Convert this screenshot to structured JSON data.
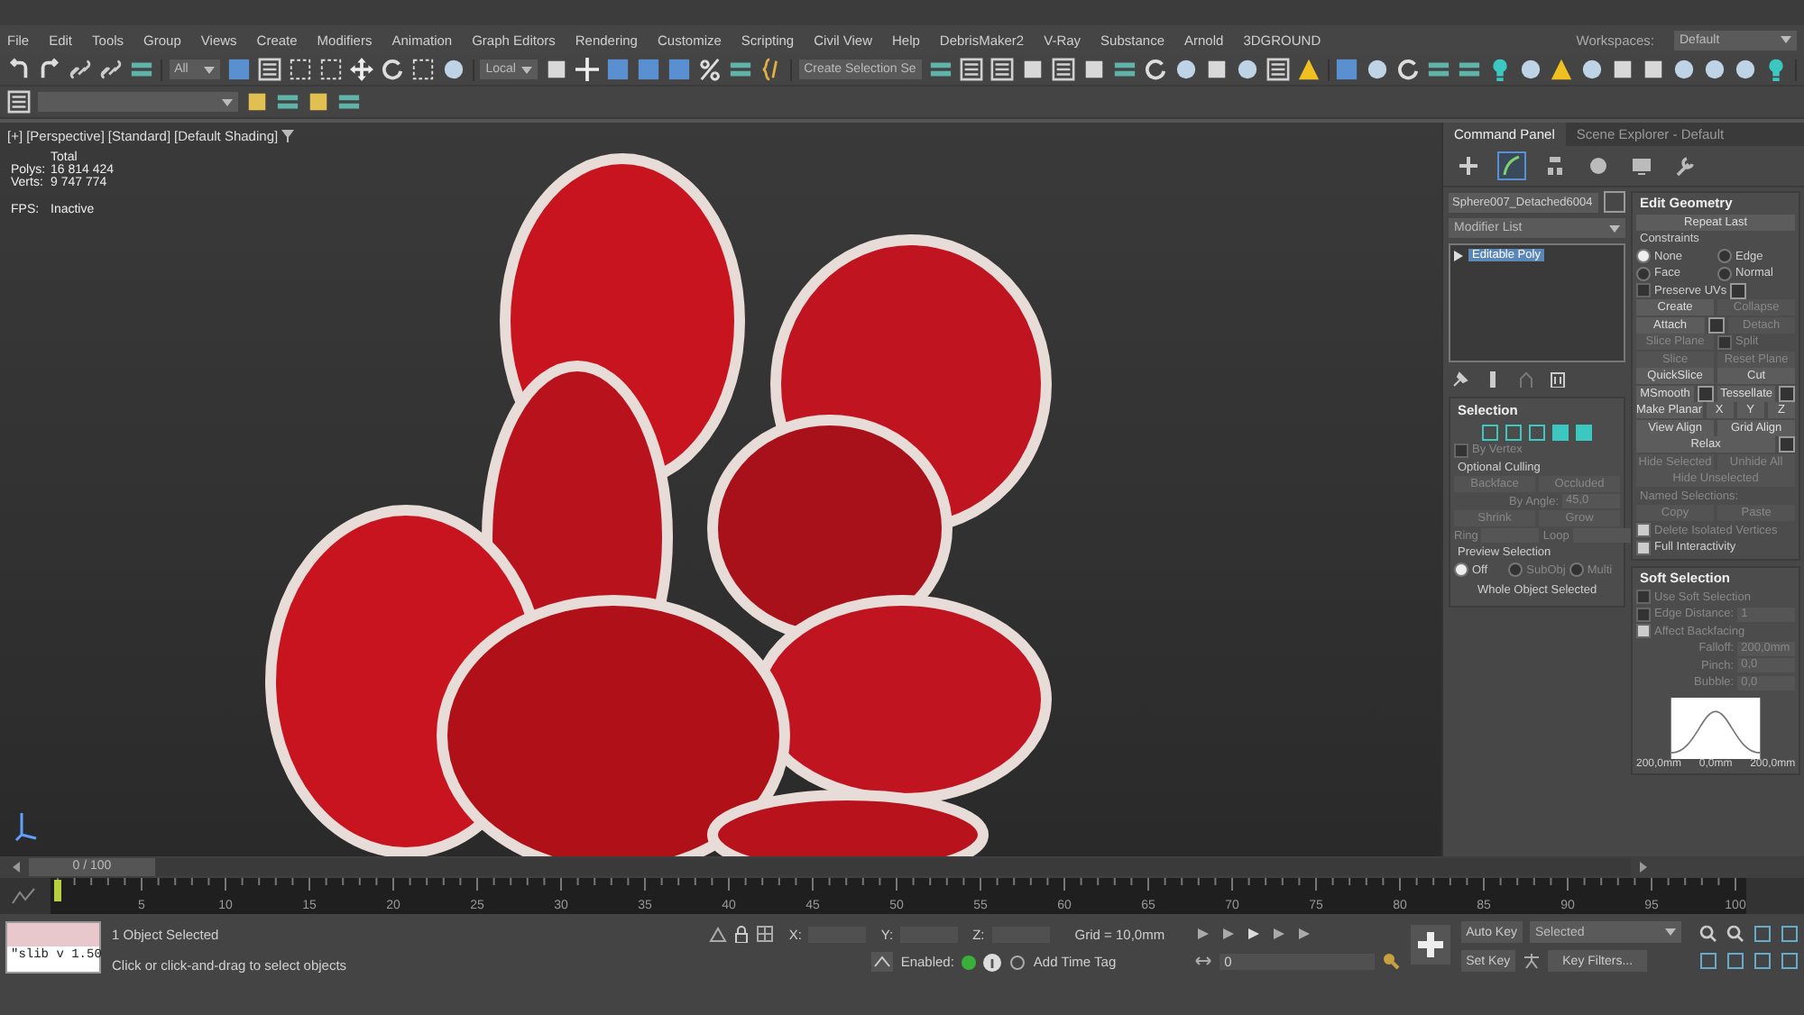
{
  "menu_bar": [
    "File",
    "Edit",
    "Tools",
    "Group",
    "Views",
    "Create",
    "Modifiers",
    "Animation",
    "Graph Editors",
    "Rendering",
    "Customize",
    "Scripting",
    "Civil View",
    "Help",
    "DebrisMaker2",
    "V-Ray",
    "Substance",
    "Arnold",
    "3DGROUND"
  ],
  "workspaces": {
    "label": "Workspaces:",
    "value": "Default"
  },
  "toolbar": {
    "selection_filter": "All",
    "reference_coord": "Local",
    "selection_set": "Create Selection Se"
  },
  "viewport": {
    "labels": [
      "[+]",
      "[Perspective]",
      "[Standard]",
      "[Default Shading]"
    ],
    "stats_title": "Total",
    "stats": [
      {
        "label": "Polys:",
        "value": "16 814 424"
      },
      {
        "label": "Verts:",
        "value": "9 747 774"
      }
    ],
    "fps": {
      "label": "FPS:",
      "value": "Inactive"
    }
  },
  "command_panel": {
    "tabs": [
      {
        "label": "Command Panel",
        "selected": true
      },
      {
        "label": "Scene Explorer - Default",
        "selected": false
      }
    ],
    "mode_tabs": [
      {
        "selected": false
      },
      {
        "selected": true
      },
      {
        "selected": false
      },
      {
        "selected": false
      },
      {
        "selected": false
      },
      {
        "selected": false
      }
    ],
    "object_name": "Sphere007_Detached6004",
    "modifier_list": "Modifier List",
    "stack": [
      {
        "label": "Editable Poly",
        "selected": true
      }
    ],
    "selection": {
      "title": "Selection",
      "rows": [
        {
          "items": [
            {
              "kind": "check",
              "label": "By Vertex",
              "checked": false,
              "disabled": true
            }
          ]
        },
        {
          "items": [
            {
              "kind": "label",
              "label": "Optional Culling"
            }
          ]
        },
        {
          "items": [
            {
              "kind": "button",
              "label": "Backface",
              "disabled": true
            },
            {
              "kind": "button",
              "label": "Occluded",
              "disabled": true
            }
          ]
        },
        {
          "items": [
            {
              "kind": "spinner",
              "label": "By Angle:",
              "value": "45,0",
              "disabled": true
            }
          ]
        },
        {
          "items": [
            {
              "kind": "button",
              "label": "Shrink",
              "disabled": true
            },
            {
              "kind": "button",
              "label": "Grow",
              "disabled": true
            }
          ]
        },
        {
          "items": [
            {
              "kind": "spinner",
              "label": "Ring",
              "disabled": true
            },
            {
              "kind": "spinner",
              "label": "Loop",
              "disabled": true
            }
          ]
        },
        {
          "items": [
            {
              "kind": "label",
              "label": "Preview Selection"
            }
          ]
        },
        {
          "items": [
            {
              "kind": "radio",
              "label": "Off",
              "selected": true,
              "disabled": false
            },
            {
              "kind": "radio",
              "label": "SubObj",
              "selected": false,
              "disabled": true
            },
            {
              "kind": "radio",
              "label": "Multi",
              "selected": false,
              "disabled": true
            }
          ]
        },
        {
          "items": [
            {
              "kind": "text",
              "label": "Whole Object Selected"
            }
          ]
        }
      ]
    },
    "edit_geometry": {
      "title": "Edit Geometry",
      "rows": [
        {
          "items": [
            {
              "kind": "button",
              "label": "Repeat Last",
              "disabled": false
            }
          ]
        },
        {
          "items": [
            {
              "kind": "label",
              "label": "Constraints"
            }
          ]
        },
        {
          "items": [
            {
              "kind": "radio",
              "label": "None",
              "selected": true,
              "disabled": false
            },
            {
              "kind": "radio",
              "label": "Edge",
              "selected": false,
              "disabled": false
            }
          ]
        },
        {
          "items": [
            {
              "kind": "radio",
              "label": "Face",
              "selected": false,
              "disabled": false
            },
            {
              "kind": "radio",
              "label": "Normal",
              "selected": false,
              "disabled": false
            }
          ]
        },
        {
          "items": [
            {
              "kind": "check",
              "label": "Preserve UVs",
              "checked": false,
              "disabled": false,
              "settings": true
            }
          ]
        },
        {
          "items": [
            {
              "kind": "button",
              "label": "Create",
              "disabled": false
            },
            {
              "kind": "button",
              "label": "Collapse",
              "disabled": true
            }
          ]
        },
        {
          "items": [
            {
              "kind": "button",
              "label": "Attach",
              "disabled": false,
              "settings": true
            },
            {
              "kind": "button",
              "label": "Detach",
              "disabled": true
            }
          ]
        },
        {
          "items": [
            {
              "kind": "button",
              "label": "Slice Plane",
              "disabled": true
            },
            {
              "kind": "check",
              "label": "Split",
              "checked": false,
              "disabled": true
            }
          ]
        },
        {
          "items": [
            {
              "kind": "button",
              "label": "Slice",
              "disabled": true
            },
            {
              "kind": "button",
              "label": "Reset Plane",
              "disabled": true
            }
          ]
        },
        {
          "items": [
            {
              "kind": "button",
              "label": "QuickSlice",
              "disabled": false
            },
            {
              "kind": "button",
              "label": "Cut",
              "disabled": false
            }
          ]
        },
        {
          "items": [
            {
              "kind": "button",
              "label": "MSmooth",
              "disabled": false,
              "settings": true
            },
            {
              "kind": "button",
              "label": "Tessellate",
              "disabled": false,
              "settings": true
            }
          ]
        },
        {
          "items": [
            {
              "kind": "button",
              "label": "Make Planar",
              "disabled": false
            },
            {
              "kind": "button",
              "label": "X",
              "disabled": false
            },
            {
              "kind": "button",
              "label": "Y",
              "disabled": false
            },
            {
              "kind": "button",
              "label": "Z",
              "disabled": false
            }
          ]
        },
        {
          "items": [
            {
              "kind": "button",
              "label": "View Align",
              "disabled": false
            },
            {
              "kind": "button",
              "label": "Grid Align",
              "disabled": false
            }
          ]
        },
        {
          "items": [
            {
              "kind": "button",
              "label": "Relax",
              "disabled": false,
              "settings": true
            }
          ]
        },
        {
          "items": [
            {
              "kind": "button",
              "label": "Hide Selected",
              "disabled": true
            },
            {
              "kind": "button",
              "label": "Unhide All",
              "disabled": true
            }
          ]
        },
        {
          "items": [
            {
              "kind": "button",
              "label": "Hide Unselected",
              "disabled": true
            }
          ]
        },
        {
          "items": [
            {
              "kind": "label",
              "label": "Named Selections:",
              "disabled": true
            }
          ]
        },
        {
          "items": [
            {
              "kind": "button",
              "label": "Copy",
              "disabled": true
            },
            {
              "kind": "button",
              "label": "Paste",
              "disabled": true
            }
          ]
        },
        {
          "items": [
            {
              "kind": "check",
              "label": "Delete Isolated Vertices",
              "checked": true,
              "disabled": true
            }
          ]
        },
        {
          "items": [
            {
              "kind": "check",
              "label": "Full Interactivity",
              "checked": true,
              "disabled": false
            }
          ]
        }
      ]
    },
    "soft_selection": {
      "title": "Soft Selection",
      "rows": [
        {
          "items": [
            {
              "kind": "check",
              "label": "Use Soft Selection",
              "checked": false,
              "disabled": true
            }
          ]
        },
        {
          "items": [
            {
              "kind": "check",
              "label": "Edge Distance:",
              "checked": false,
              "disabled": true
            },
            {
              "kind": "spinner",
              "value": "1",
              "disabled": true
            }
          ]
        },
        {
          "items": [
            {
              "kind": "check",
              "label": "Affect Backfacing",
              "checked": true,
              "disabled": true
            }
          ]
        },
        {
          "items": [
            {
              "kind": "spinner",
              "label": "Falloff:",
              "value": "200,0mm",
              "disabled": true
            }
          ]
        },
        {
          "items": [
            {
              "kind": "spinner",
              "label": "Pinch:",
              "value": "0,0",
              "disabled": true
            }
          ]
        },
        {
          "items": [
            {
              "kind": "spinner",
              "label": "Bubble:",
              "value": "0,0",
              "disabled": true
            }
          ]
        }
      ],
      "curve_labels": [
        "200,0mm",
        "0,0mm",
        "200,0mm"
      ]
    }
  },
  "time_slider": {
    "label": "0 / 100",
    "level": 0
  },
  "track_ticks": [
    "5",
    "10",
    "15",
    "20",
    "25",
    "30",
    "35",
    "40",
    "45",
    "50",
    "55",
    "60",
    "65",
    "70",
    "75",
    "80",
    "85",
    "90",
    "95",
    "100"
  ],
  "status": {
    "maxscript": "\"slib v 1.50",
    "selection": "1 Object Selected",
    "prompt": "Click or click-and-drag to select objects",
    "coords": [
      "X:",
      "Y:",
      "Z:"
    ],
    "grid": "Grid = 10,0mm",
    "enabled_label": "Enabled:",
    "enabled": true,
    "time_tag": "Add Time Tag",
    "frame": "0",
    "auto_key": "Auto Key",
    "set_key": "Set Key",
    "key_mode": "Selected",
    "key_filters": "Key Filters..."
  }
}
